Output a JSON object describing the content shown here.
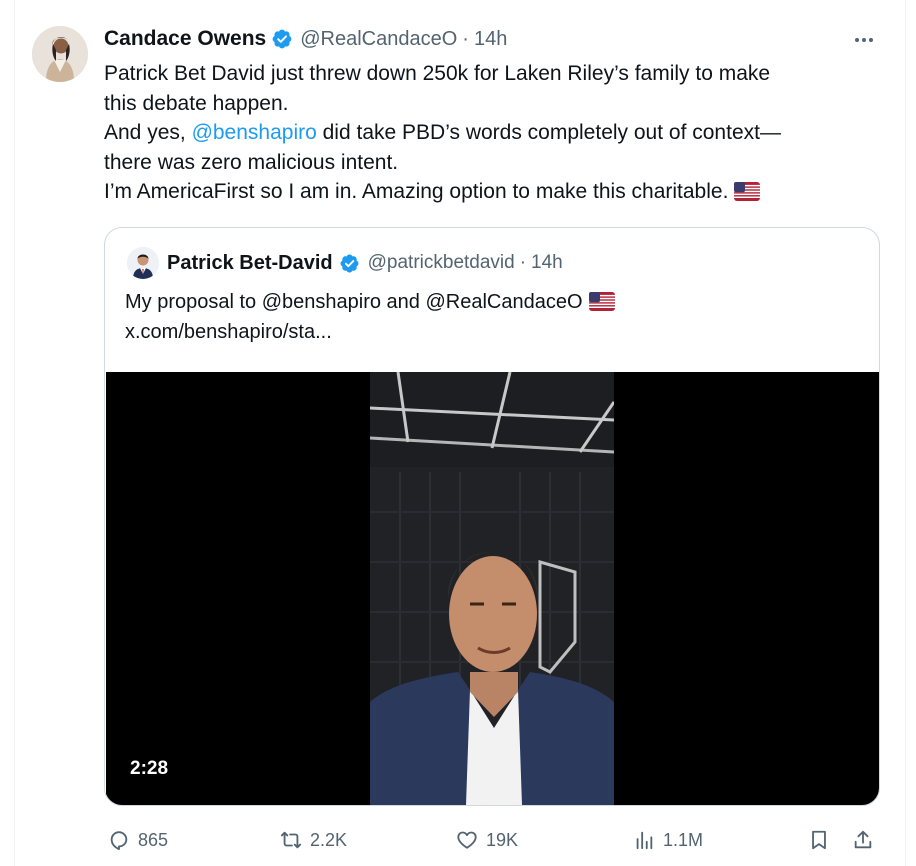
{
  "tweet": {
    "author_name": "Candace Owens",
    "handle": "@RealCandaceO",
    "separator": "·",
    "time": "14h",
    "verified": true,
    "lines": [
      "Patrick Bet David just threw down 250k for Laken Riley’s family to make",
      "this debate happen."
    ],
    "line3_pre": "And yes, ",
    "line3_mention": "@benshapiro",
    "line3_post": " did take PBD’s words completely out of context—",
    "line4": "there was zero malicious intent.",
    "line5": "I’m AmericaFirst so I am in. Amazing option to make this charitable.",
    "line5_emoji": "us-flag-icon"
  },
  "quoted": {
    "author_name": "Patrick Bet-David",
    "handle": "@patrickbetdavid",
    "separator": "·",
    "time": "14h",
    "verified": true,
    "text_line1": "My proposal to @benshapiro and @RealCandaceO",
    "text_line1_emoji": "us-flag-icon",
    "text_line2": "x.com/benshapiro/sta...",
    "video_duration": "2:28"
  },
  "actions": {
    "replies": "865",
    "reposts": "2.2K",
    "likes": "19K",
    "views": "1.1M"
  },
  "colors": {
    "link": "#1d9bf0",
    "text": "#0f1419",
    "secondary": "#536471",
    "border": "#cfd9de",
    "verified": "#1d9bf0"
  }
}
